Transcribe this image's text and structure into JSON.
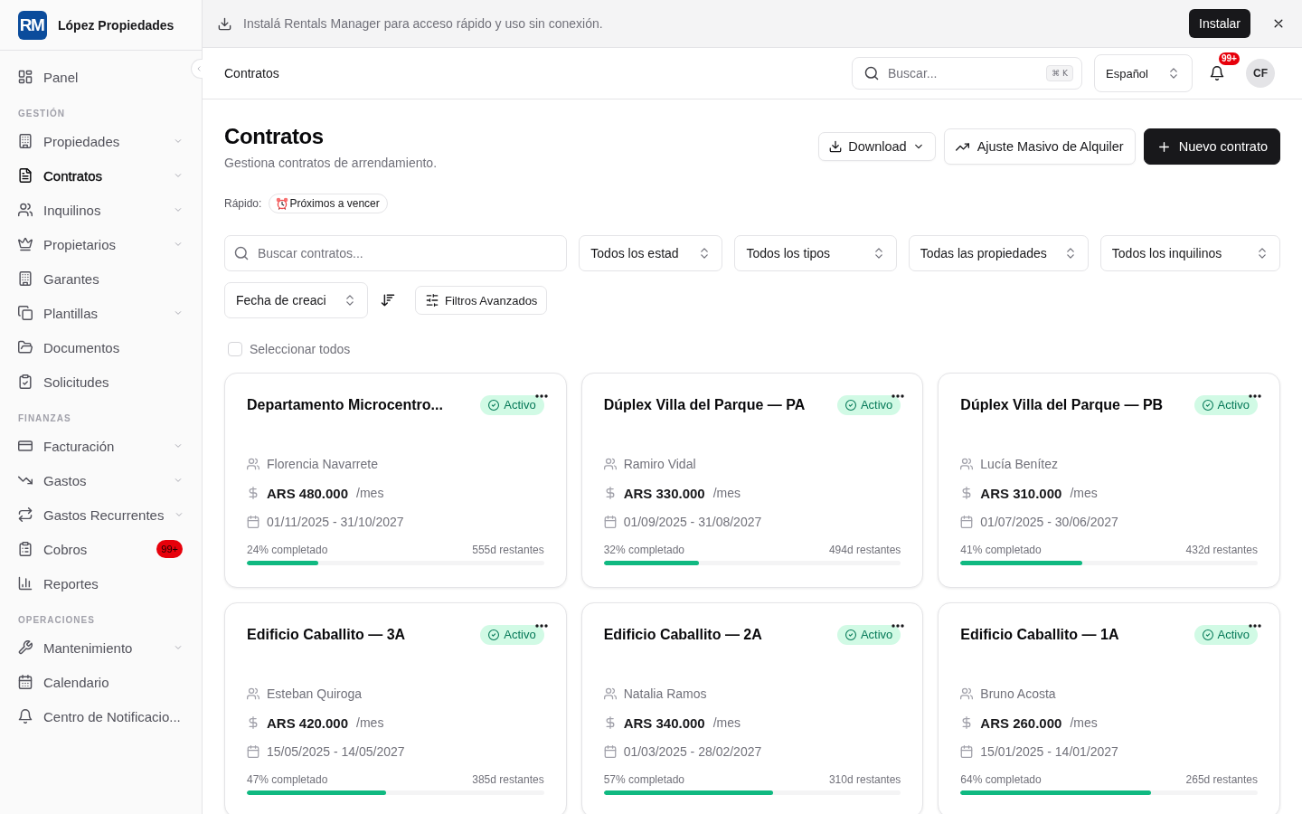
{
  "sidebar": {
    "brand": {
      "logo": "RM",
      "name": "López Propiedades"
    },
    "sections": [
      {
        "items": [
          {
            "label": "Panel",
            "selected": false,
            "has_submenu": false
          }
        ]
      },
      {
        "label": "GESTIÓN",
        "items": [
          {
            "label": "Propiedades",
            "selected": false,
            "has_submenu": true
          },
          {
            "label": "Contratos",
            "selected": true,
            "has_submenu": true
          },
          {
            "label": "Inquilinos",
            "selected": false,
            "has_submenu": true
          },
          {
            "label": "Propietarios",
            "selected": false,
            "has_submenu": true
          },
          {
            "label": "Garantes",
            "selected": false,
            "has_submenu": false
          },
          {
            "label": "Plantillas",
            "selected": false,
            "has_submenu": true
          },
          {
            "label": "Documentos",
            "selected": false,
            "has_submenu": false
          },
          {
            "label": "Solicitudes",
            "selected": false,
            "has_submenu": false
          }
        ]
      },
      {
        "label": "FINANZAS",
        "items": [
          {
            "label": "Facturación",
            "selected": false,
            "has_submenu": true
          },
          {
            "label": "Gastos",
            "selected": false,
            "has_submenu": true
          },
          {
            "label": "Gastos Recurrentes",
            "selected": false,
            "has_submenu": true
          },
          {
            "label": "Cobros",
            "selected": false,
            "has_submenu": false,
            "badge": "99+"
          },
          {
            "label": "Reportes",
            "selected": false,
            "has_submenu": false
          }
        ]
      },
      {
        "label": "OPERACIONES",
        "items": [
          {
            "label": "Mantenimiento",
            "selected": false,
            "has_submenu": true
          },
          {
            "label": "Calendario",
            "selected": false,
            "has_submenu": false
          },
          {
            "label": "Centro de Notificacio...",
            "selected": false,
            "has_submenu": false
          }
        ]
      }
    ]
  },
  "install_banner": {
    "message": "Instalá Rentals Manager para acceso rápido y uso sin conexión.",
    "button": "Instalar"
  },
  "top_bar": {
    "title": "Contratos",
    "search": {
      "placeholder": "Buscar...",
      "shortcut": "⌘ K"
    },
    "language": "Español",
    "notifications_badge": "99+",
    "avatar": "CF"
  },
  "page_header": {
    "title": "Contratos",
    "subtitle": "Gestiona contratos de arrendamiento.",
    "actions": [
      {
        "label": "Download",
        "kind": "dropdown"
      },
      {
        "label": "Ajuste Masivo de Alquiler",
        "kind": "outline"
      },
      {
        "label": "Nuevo contrato",
        "kind": "primary"
      }
    ]
  },
  "quick_filters": {
    "label": "Rápido:",
    "chips": [
      {
        "label": "Próximos a vencer",
        "selected": false
      }
    ]
  },
  "filters": {
    "search": {
      "placeholder": "Buscar contratos..."
    },
    "selects": [
      "Todos los estad",
      "Todos los tipos",
      "Todas las propiedades",
      "Todos los inquilinos"
    ],
    "sort_by": "Fecha de creaci",
    "advanced_button": "Filtros Avanzados"
  },
  "select_all": {
    "label": "Seleccionar todos",
    "checked": false
  },
  "contracts": [
    {
      "title": "Departamento Microcentro...",
      "status": "Activo",
      "tenant": "Florencia Navarrete",
      "amount": "ARS 480.000",
      "period": "/mes",
      "dates": "01/11/2025 - 31/10/2027",
      "progress_label": "24% completado",
      "remaining": "555d restantes",
      "level": 0.24
    },
    {
      "title": "Dúplex Villa del Parque — PA",
      "status": "Activo",
      "tenant": "Ramiro Vidal",
      "amount": "ARS 330.000",
      "period": "/mes",
      "dates": "01/09/2025 - 31/08/2027",
      "progress_label": "32% completado",
      "remaining": "494d restantes",
      "level": 0.32
    },
    {
      "title": "Dúplex Villa del Parque — PB",
      "status": "Activo",
      "tenant": "Lucía Benítez",
      "amount": "ARS 310.000",
      "period": "/mes",
      "dates": "01/07/2025 - 30/06/2027",
      "progress_label": "41% completado",
      "remaining": "432d restantes",
      "level": 0.41
    },
    {
      "title": "Edificio Caballito — 3A",
      "status": "Activo",
      "tenant": "Esteban Quiroga",
      "amount": "ARS 420.000",
      "period": "/mes",
      "dates": "15/05/2025 - 14/05/2027",
      "progress_label": "47% completado",
      "remaining": "385d restantes",
      "level": 0.47
    },
    {
      "title": "Edificio Caballito — 2A",
      "status": "Activo",
      "tenant": "Natalia Ramos",
      "amount": "ARS 340.000",
      "period": "/mes",
      "dates": "01/03/2025 - 28/02/2027",
      "progress_label": "57% completado",
      "remaining": "310d restantes",
      "level": 0.57
    },
    {
      "title": "Edificio Caballito — 1A",
      "status": "Activo",
      "tenant": "Bruno Acosta",
      "amount": "ARS 260.000",
      "period": "/mes",
      "dates": "15/01/2025 - 14/01/2027",
      "progress_label": "64% completado",
      "remaining": "265d restantes",
      "level": 0.64
    }
  ]
}
